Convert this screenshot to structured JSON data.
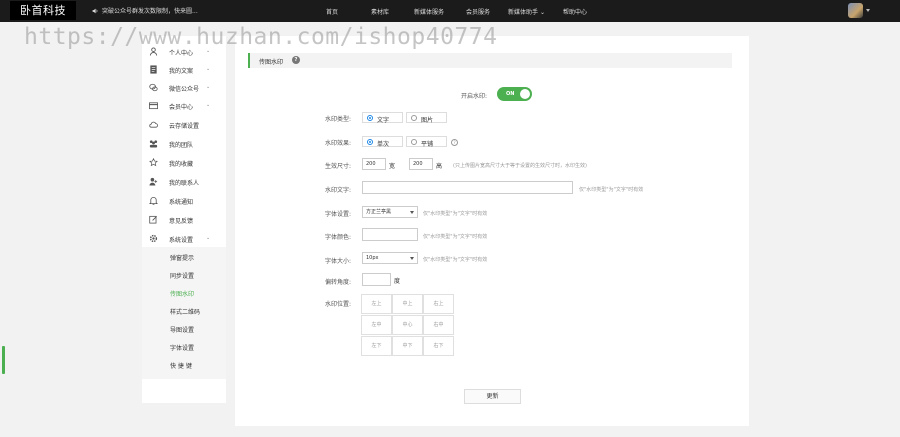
{
  "header": {
    "logo_text": "卧首科技",
    "notice": "突破公众号群发次数限制，快来圆...",
    "nav": [
      "首页",
      "素材库",
      "新媒体服务",
      "会员服务",
      "新媒体助手",
      "帮助中心"
    ],
    "nav_dropdown_caret": "⌄"
  },
  "watermark": "https://www.huzhan.com/ishop40774",
  "sidebar": {
    "items": [
      {
        "label": "个人中心",
        "icon": "user-icon",
        "chevron": "⌄"
      },
      {
        "label": "我的文案",
        "icon": "document-icon",
        "chevron": "⌄"
      },
      {
        "label": "微信公众号",
        "icon": "wechat-icon",
        "chevron": "⌄"
      },
      {
        "label": "会员中心",
        "icon": "card-icon",
        "chevron": "⌄"
      },
      {
        "label": "云存储设置",
        "icon": "cloud-icon",
        "chevron": ""
      },
      {
        "label": "我的团队",
        "icon": "team-icon",
        "chevron": ""
      },
      {
        "label": "我的收藏",
        "icon": "star-icon",
        "chevron": ""
      },
      {
        "label": "我的联系人",
        "icon": "contact-icon",
        "chevron": ""
      },
      {
        "label": "系统通知",
        "icon": "bell-icon",
        "chevron": ""
      },
      {
        "label": "意见反馈",
        "icon": "edit-icon",
        "chevron": ""
      },
      {
        "label": "系统设置",
        "icon": "gear-icon",
        "chevron": "⌄"
      }
    ],
    "sub_items": [
      "弹窗提示",
      "同步设置",
      "传图水印",
      "样式二维码",
      "导图设置",
      "字体设置",
      "快 捷 键"
    ],
    "active_sub": "传图水印"
  },
  "panel": {
    "title": "传图水印",
    "help": "?",
    "enable_label": "开启水印:",
    "toggle_text": "ON",
    "type_label": "水印类型:",
    "type_options": [
      "文字",
      "图片"
    ],
    "effect_label": "水印效果:",
    "effect_options": [
      "单次",
      "平铺"
    ],
    "size_label": "生效尺寸:",
    "size_width": "200",
    "size_width_unit": "宽",
    "size_height": "200",
    "size_height_unit": "高",
    "size_note": "(只上传图片宽高尺寸大于等于设置的生效尺寸时，水印生效)",
    "text_label": "水印文字:",
    "text_value": "",
    "text_note": "仅\"水印类型\"为\"文字\"时有效",
    "font_label": "字体设置:",
    "font_value": "方正兰亭黑",
    "font_note": "仅\"水印类型\"为\"文字\"时有效",
    "color_label": "字体颜色:",
    "color_value": "",
    "color_note": "仅\"水印类型\"为\"文字\"时有效",
    "fontsize_label": "字体大小:",
    "fontsize_value": "10px",
    "fontsize_note": "仅\"水印类型\"为\"文字\"时有效",
    "rotate_label": "偏转角度:",
    "rotate_value": "",
    "rotate_unit": "度",
    "position_label": "水印位置:",
    "positions": [
      "左上",
      "中上",
      "右上",
      "左中",
      "中心",
      "右中",
      "左下",
      "中下",
      "右下"
    ],
    "submit": "更新"
  },
  "colors": {
    "accent": "#4caf50",
    "topbar": "#1b1b1b",
    "radio": "#1e88e5"
  }
}
